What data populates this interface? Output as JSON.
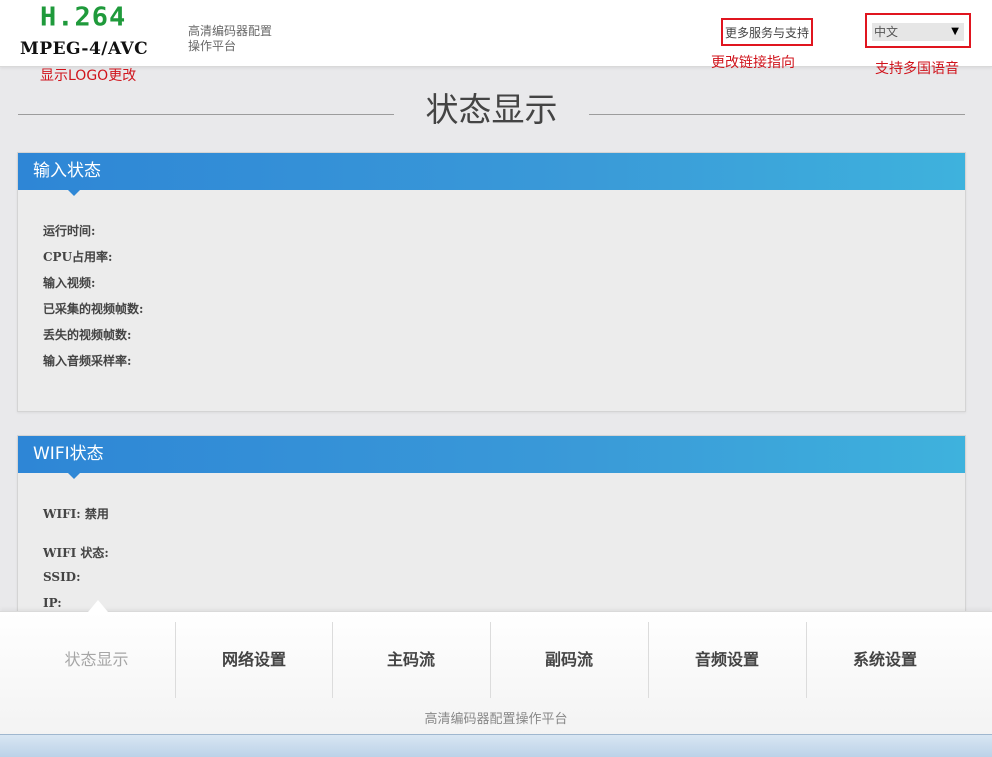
{
  "header": {
    "logo_line1": "H.264",
    "logo_line2": "MPEG-4/AVC",
    "subtitle_line1": "高清编码器配置",
    "subtitle_line2": "操作平台",
    "more_link": "更多服务与支持",
    "language": "中文"
  },
  "annotations": {
    "logo": "显示LOGO更改",
    "link": "更改链接指向",
    "language": "支持多国语音"
  },
  "page_title": "状态显示",
  "input_panel": {
    "title": "输入状态",
    "rows": [
      "运行时间:",
      "CPU占用率:",
      "输入视频:",
      "已采集的视频帧数:",
      "丢失的视频帧数:",
      "输入音频采样率:"
    ]
  },
  "wifi_panel": {
    "title": "WIFI状态",
    "rows": [
      "WIFI: 禁用",
      "WIFI 状态:",
      "SSID:",
      "IP:"
    ]
  },
  "nav": {
    "items": [
      "状态显示",
      "网络设置",
      "主码流",
      "副码流",
      "音频设置",
      "系统设置"
    ],
    "footer": "高清编码器配置操作平台"
  },
  "colors": {
    "panel_header": "#3a9ad8",
    "annotation_red": "#e0151f",
    "logo_green": "#1f9a3b"
  }
}
